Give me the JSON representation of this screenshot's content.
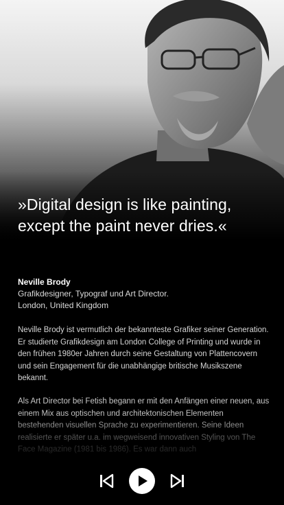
{
  "hero": {
    "quote": "»Digital design is like painting, except the paint never dries.«"
  },
  "bio": {
    "name": "Neville Brody",
    "role": "Grafikdesigner, Typograf und Art Director.",
    "location": "London, United Kingdom"
  },
  "paragraphs": [
    "Neville Brody ist vermutlich der bekannteste Grafiker seiner Generation. Er studierte Grafikdesign am London College of Printing und wurde in den frühen 1980er Jahren durch seine Gestaltung von Plattencovern und sein Engagement für die unabhängige britische Musikszene bekannt.",
    "Als Art Director bei Fetish begann er mit den Anfängen einer neuen, aus einem Mix aus optischen und architektonischen Elementen bestehenden visuellen Sprache zu experimentieren. Seine Ideen realisierte er später u.a. im wegweisend innovativen Styling von The Face Magazine (1981 bis 1986). Es war dann auch"
  ],
  "player": {
    "icons": [
      "skip-previous-icon",
      "play-icon",
      "skip-next-icon"
    ]
  }
}
